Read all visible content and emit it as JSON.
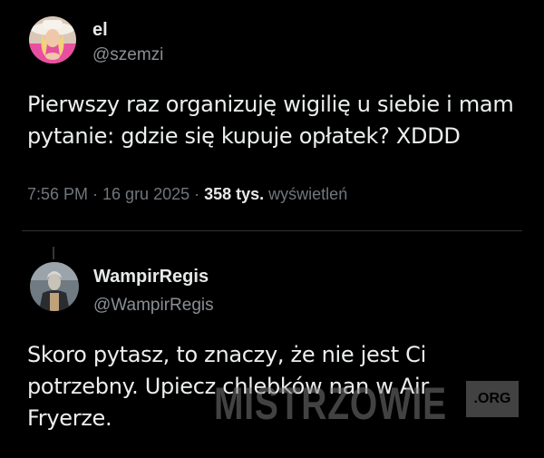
{
  "tweet1": {
    "display_name": "el",
    "handle": "@szemzi",
    "text_line1": "Pierwszy raz organizuję wigilię u siebie i mam",
    "text_line2": "pytanie: gdzie się kupuje opłatek? XDDD",
    "time": "7:56 PM · 16 gru 2025 · ",
    "views_count": "358 tys.",
    "views_label": " wyświetleń"
  },
  "tweet2": {
    "display_name": "WampirRegis",
    "handle": "@WampirRegis",
    "text_line1": "Skoro pytasz, to znaczy, że nie jest Ci",
    "text_line2": "potrzebny. Upiecz chlebków nan w Air",
    "text_line3": "Fryerze."
  },
  "watermark": {
    "text": "MISTRZOWIE",
    "suffix": ".ORG"
  },
  "colors": {
    "background": "#000000",
    "text": "#e7e9ea",
    "muted": "#71767b",
    "divider": "#2f3336"
  }
}
